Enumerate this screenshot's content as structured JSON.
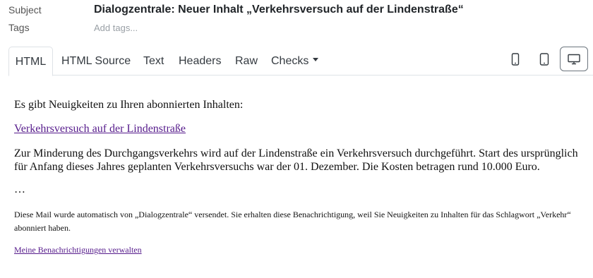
{
  "header": {
    "subject_label": "Subject",
    "subject_value": "Dialogzentrale: Neuer Inhalt „Verkehrsversuch auf der Lindenstraße“",
    "tags_label": "Tags",
    "tags_placeholder": "Add tags..."
  },
  "tabs": [
    {
      "label": "HTML",
      "active": true
    },
    {
      "label": "HTML Source"
    },
    {
      "label": "Text"
    },
    {
      "label": "Headers"
    },
    {
      "label": "Raw"
    },
    {
      "label": "Checks"
    }
  ],
  "device_buttons": [
    {
      "icon": "mobile-icon"
    },
    {
      "icon": "tablet-icon"
    },
    {
      "icon": "desktop-icon",
      "active": true
    }
  ],
  "email": {
    "intro": "Es gibt Neuigkeiten zu Ihren abonnierten Inhalten:",
    "item_link": "Verkehrsversuch auf der Lindenstraße",
    "item_text": "Zur Minderung des Durchgangsverkehrs wird auf der Lindenstraße ein Verkehrsversuch durchgeführt. Start des ursprünglich für Anfang dieses Jahres geplanten Verkehrsversuchs war der 01. Dezember. Die Kosten betragen rund 10.000 Euro.",
    "ellipsis": "…",
    "footer": "Diese Mail wurde automatisch von „Dialogzentrale“ versendet. Sie erhalten diese Benachrichtigung, weil Sie Neuigkeiten zu Inhalten für das Schlagwort „Verkehr“ abonniert haben.",
    "manage_link": "Meine Benachrichtigungen verwalten"
  },
  "colors": {
    "link": "#551a8b",
    "tab_border": "#dee2e6",
    "placeholder": "#9aa0a6"
  }
}
